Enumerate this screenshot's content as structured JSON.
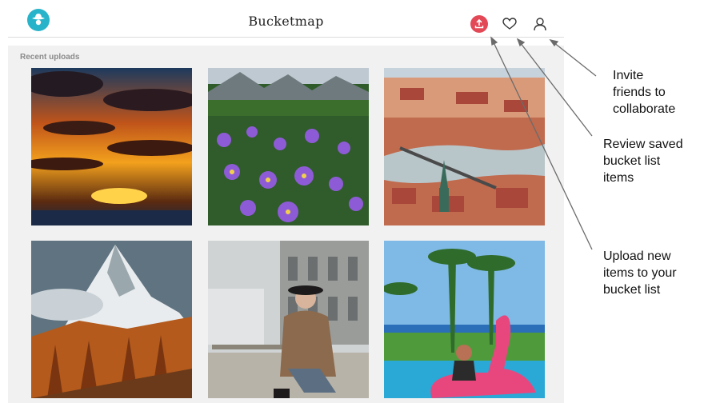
{
  "app": {
    "title": "Bucketmap"
  },
  "header": {
    "icons": {
      "logo": "hat-logo-icon",
      "upload": "upload-icon",
      "saved": "heart-icon",
      "profile": "user-icon"
    },
    "accent_color": "#e24856",
    "logo_color": "#27b3c9"
  },
  "feed": {
    "section_title": "Recent uploads",
    "tiles": [
      {
        "subject": "sunset-over-sea"
      },
      {
        "subject": "purple-wildflowers-in-mountains"
      },
      {
        "subject": "city-rooftops-and-river"
      },
      {
        "subject": "snowy-mountain-peak-autumn-forest"
      },
      {
        "subject": "woman-in-fur-coat-sitting"
      },
      {
        "subject": "woman-on-pink-flamingo-pool"
      }
    ]
  },
  "annotations": {
    "invite": [
      "Invite",
      "friends to",
      "collaborate"
    ],
    "review": [
      "Review saved",
      "bucket list",
      "items"
    ],
    "upload": [
      "Upload new",
      "items to your",
      "bucket list"
    ]
  }
}
